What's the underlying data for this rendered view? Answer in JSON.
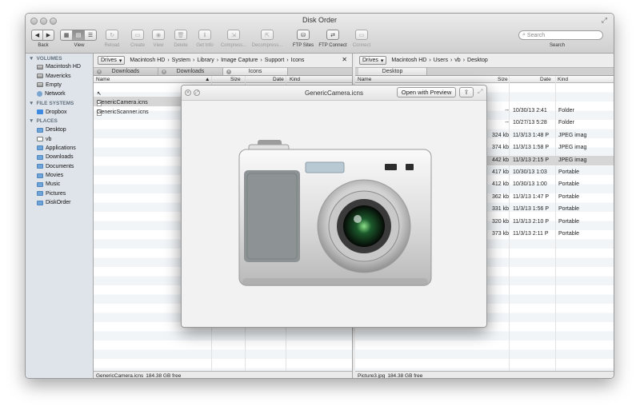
{
  "window": {
    "title": "Disk Order"
  },
  "toolbar": {
    "back_label": "Back",
    "view_label": "View",
    "back_glyph": "◀",
    "forward_glyph": "▶",
    "actions": [
      {
        "label": "Reload",
        "icon": "reload-icon",
        "glyph": "↻",
        "enabled": false
      },
      {
        "label": "Create",
        "icon": "create-icon",
        "glyph": "▭",
        "enabled": false
      },
      {
        "label": "View",
        "icon": "eye-icon",
        "glyph": "◉",
        "enabled": false
      },
      {
        "label": "Delete",
        "icon": "trash-icon",
        "glyph": "🗑",
        "enabled": false
      },
      {
        "label": "Get Info",
        "icon": "info-icon",
        "glyph": "ℹ",
        "enabled": false
      },
      {
        "label": "Compress...",
        "icon": "compress-icon",
        "glyph": "⇲",
        "enabled": false
      },
      {
        "label": "Decompress...",
        "icon": "decompress-icon",
        "glyph": "⇱",
        "enabled": false
      },
      {
        "label": "FTP Sites",
        "icon": "ftp-sites-icon",
        "glyph": "⛁",
        "enabled": true
      },
      {
        "label": "FTP Connect",
        "icon": "ftp-connect-icon",
        "glyph": "⇄",
        "enabled": true
      },
      {
        "label": "Connect",
        "icon": "connect-icon",
        "glyph": "▭",
        "enabled": false
      }
    ],
    "search_placeholder": "Search",
    "search_label": "Search"
  },
  "sidebar": {
    "sections": [
      {
        "title": "VOLUMES",
        "items": [
          {
            "label": "Macintosh HD",
            "icon": "hard-disk-icon"
          },
          {
            "label": "Mavericks",
            "icon": "hard-disk-icon"
          },
          {
            "label": "Empty",
            "icon": "hard-disk-icon"
          },
          {
            "label": "Network",
            "icon": "network-icon"
          }
        ]
      },
      {
        "title": "FILE SYSTEMS",
        "items": [
          {
            "label": "Dropbox",
            "icon": "dropbox-icon"
          }
        ]
      },
      {
        "title": "PLACES",
        "items": [
          {
            "label": "Desktop",
            "icon": "folder-icon"
          },
          {
            "label": "vb",
            "icon": "home-icon"
          },
          {
            "label": "Applications",
            "icon": "folder-icon"
          },
          {
            "label": "Downloads",
            "icon": "folder-icon"
          },
          {
            "label": "Documents",
            "icon": "folder-icon"
          },
          {
            "label": "Movies",
            "icon": "folder-icon"
          },
          {
            "label": "Music",
            "icon": "folder-icon"
          },
          {
            "label": "Pictures",
            "icon": "folder-icon"
          },
          {
            "label": "DiskOrder",
            "icon": "folder-icon"
          }
        ]
      }
    ]
  },
  "left_pane": {
    "drives_label": "Drives",
    "path": [
      "Macintosh HD",
      "System",
      "Library",
      "Image Capture",
      "Support",
      "Icons"
    ],
    "tabs": [
      "Downloads",
      "Downloads",
      "Icons"
    ],
    "columns": {
      "name": "Name",
      "size": "Size",
      "date": "Date",
      "kind": "Kind"
    },
    "files": [
      {
        "name": "..",
        "size": "",
        "date": "",
        "kind": ""
      },
      {
        "name": "GenericCamera.icns",
        "size": "",
        "date": "",
        "kind": ""
      },
      {
        "name": "GenericScanner.icns",
        "size": "",
        "date": "",
        "kind": ""
      }
    ],
    "status_file": "GenericCamera.icns",
    "status_free": "184.38 GB free"
  },
  "right_pane": {
    "drives_label": "Drives",
    "path": [
      "Macintosh HD",
      "Users",
      "vb",
      "Desktop"
    ],
    "tabs": [
      "Desktop"
    ],
    "columns": {
      "name": "Name",
      "size": "Size",
      "date": "Date",
      "kind": "Kind"
    },
    "files": [
      {
        "size": "--",
        "date": "10/30/13 2:41",
        "kind": "Folder"
      },
      {
        "size": "--",
        "date": "10/27/13 5:28",
        "kind": "Folder"
      },
      {
        "size": "324 kb",
        "date": "11/3/13 1:48 P",
        "kind": "JPEG imag"
      },
      {
        "size": "374 kb",
        "date": "11/3/13 1:58 P",
        "kind": "JPEG imag"
      },
      {
        "size": "442 kb",
        "date": "11/3/13 2:15 P",
        "kind": "JPEG imag"
      },
      {
        "size": "417 kb",
        "date": "10/30/13 1:03",
        "kind": "Portable"
      },
      {
        "size": "412 kb",
        "date": "10/30/13 1:00",
        "kind": "Portable"
      },
      {
        "size": "362 kb",
        "date": "11/3/13 1:47 P",
        "kind": "Portable"
      },
      {
        "size": "331 kb",
        "date": "11/3/13 1:56 P",
        "kind": "Portable"
      },
      {
        "size": "320 kb",
        "date": "11/3/13 2:10 P",
        "kind": "Portable"
      },
      {
        "size": "373 kb",
        "date": "11/3/13 2:11 P",
        "kind": "Portable"
      }
    ],
    "selected_index": 4,
    "status_file": "Picture3.jpg",
    "status_free": "184.38 GB free"
  },
  "quicklook": {
    "title": "GenericCamera.icns",
    "open_with_label": "Open with Preview"
  }
}
